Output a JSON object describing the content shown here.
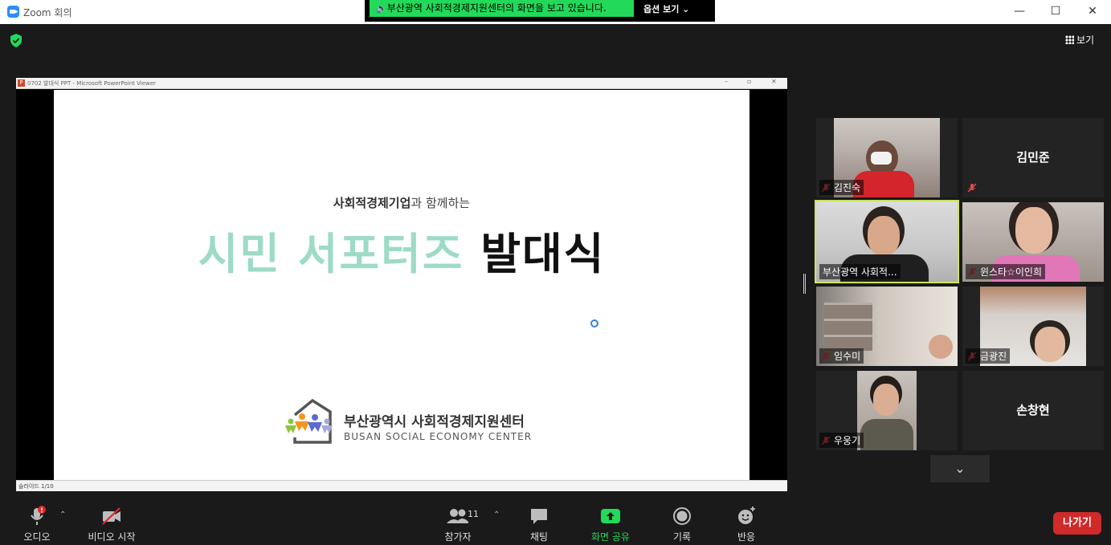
{
  "window": {
    "title": "Zoom 회의",
    "minimize": "—",
    "maximize": "☐",
    "close": "✕"
  },
  "share_banner": {
    "text": "부산광역 사회적경제지원센터의 화면을 보고 있습니다.",
    "options": "옵션 보기 ⌄"
  },
  "view_button": "보기",
  "ppt": {
    "window_title": "0702 발대식 PPT - Microsoft PowerPoint Viewer",
    "status": "슬라이드 1/10"
  },
  "slide": {
    "subtitle_bold": "사회적경제기업",
    "subtitle_rest": "과 함께하는",
    "title_green": "시민 서포터즈",
    "title_black": "발대식",
    "logo_ko": "부산광역시 사회적경제지원센터",
    "logo_en": "BUSAN SOCIAL ECONOMY CENTER"
  },
  "participants": [
    {
      "name": "김진숙",
      "muted": true,
      "video": true
    },
    {
      "name": "김민준",
      "muted": true,
      "video": false
    },
    {
      "name": "부산광역 사회적...",
      "muted": false,
      "video": true,
      "active": true
    },
    {
      "name": "윈스타☆이인희",
      "muted": true,
      "video": true
    },
    {
      "name": "임수미",
      "muted": true,
      "video": true
    },
    {
      "name": "금광진",
      "muted": true,
      "video": true
    },
    {
      "name": "우웅기",
      "muted": true,
      "video": true
    },
    {
      "name": "손창현",
      "muted": false,
      "video": false
    }
  ],
  "toolbar": {
    "audio": "오디오",
    "video": "비디오 시작",
    "participants": "참가자",
    "participants_count": "11",
    "chat": "채팅",
    "share": "화면 공유",
    "record": "기록",
    "reactions": "반응",
    "leave": "나가기",
    "audio_alert": "!"
  },
  "colors": {
    "share_green": "#23d959",
    "active_border": "#c9e462",
    "leave_red": "#d02a2a",
    "slide_green": "#9edbc7"
  }
}
